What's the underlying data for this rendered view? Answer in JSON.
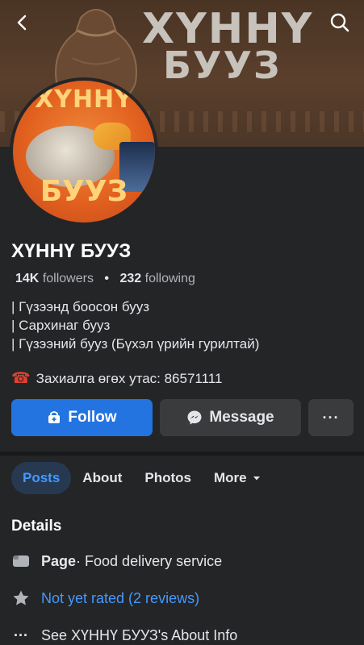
{
  "cover": {
    "title_line_1": "ХҮННҮ",
    "title_line_2": "БУУЗ"
  },
  "avatar": {
    "word_top": "ХҮННҮ",
    "word_bottom": "БУУЗ"
  },
  "icons": {
    "back": "back-arrow-icon",
    "search": "search-icon",
    "phone": "telephone-icon",
    "follow": "add-person-icon",
    "message": "messenger-icon",
    "more": "ellipsis-icon",
    "page": "page-icon",
    "rating": "star-icon",
    "about": "ellipsis-icon"
  },
  "profile": {
    "name": "ХҮННҮ БУУЗ",
    "followers_count": "14K",
    "followers_label": "followers",
    "following_count": "232",
    "following_label": "following",
    "bio": [
      "| Гүзээнд боосон бууз",
      "| Сархинаг бууз",
      "| Гүзээний бууз (Бүхэл үрийн гурилтай)"
    ],
    "contact": "Захиалга өгөх утас: 86571111"
  },
  "actions": {
    "follow_label": "Follow",
    "message_label": "Message",
    "more_label": "···"
  },
  "tabs": [
    {
      "label": "Posts",
      "active": true
    },
    {
      "label": "About",
      "active": false
    },
    {
      "label": "Photos",
      "active": false
    },
    {
      "label": "More",
      "active": false
    }
  ],
  "details": {
    "title": "Details",
    "page_label": "Page",
    "page_category": " · Food delivery service",
    "rating_text": "Not yet rated (2 reviews)",
    "about_text": "See ХҮННҮ БУУЗ's About Info"
  },
  "colors": {
    "background": "#242527",
    "accent": "#2374e1",
    "link": "#4599ff",
    "tab_active_bg": "#263951"
  }
}
